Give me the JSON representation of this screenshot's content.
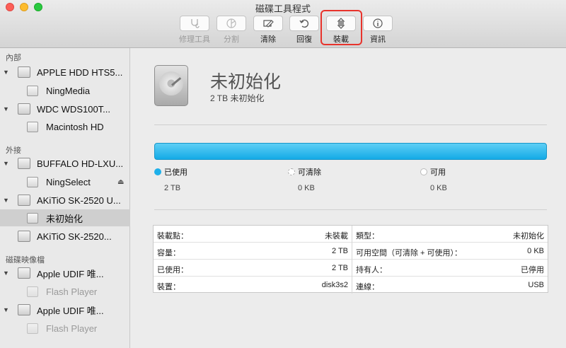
{
  "window": {
    "title": "磁碟工具程式"
  },
  "toolbar": {
    "first_aid": {
      "label": "修理工具",
      "icon": "stethoscope-icon"
    },
    "partition": {
      "label": "分割",
      "icon": "partition-icon"
    },
    "erase": {
      "label": "清除",
      "icon": "erase-icon"
    },
    "restore": {
      "label": "回復",
      "icon": "restore-icon"
    },
    "mount": {
      "label": "裝載",
      "icon": "mount-icon"
    },
    "info": {
      "label": "資訊",
      "icon": "info-icon"
    }
  },
  "sidebar": {
    "internal_header": "內部",
    "external_header": "外接",
    "images_header": "磁碟映像檔",
    "internal": [
      {
        "disk": "APPLE HDD HTS5...",
        "volume": "NingMedia"
      },
      {
        "disk": "WDC WDS100T...",
        "volume": "Macintosh HD"
      }
    ],
    "external": [
      {
        "disk": "BUFFALO HD-LXU...",
        "volume": "NingSelect"
      },
      {
        "disk": "AKiTiO SK-2520 U...",
        "volume": "未初始化"
      },
      {
        "disk": "AKiTiO SK-2520..."
      }
    ],
    "images": [
      {
        "disk": "Apple UDIF 唯...",
        "volume": "Flash Player"
      },
      {
        "disk": "Apple UDIF 唯...",
        "volume": "Flash Player"
      }
    ]
  },
  "main": {
    "disk_name": "未初始化",
    "disk_subtitle": "2 TB 未初始化",
    "usage_fraction": 1.0,
    "legend": {
      "used_label": "已使用",
      "used_value": "2 TB",
      "used_color": "#1eb0ea",
      "purgeable_label": "可清除",
      "purgeable_value": "0 KB",
      "free_label": "可用",
      "free_value": "0 KB"
    },
    "info_left": [
      {
        "key": "裝載點：",
        "value": "未裝載"
      },
      {
        "key": "容量：",
        "value": "2 TB"
      },
      {
        "key": "已使用：",
        "value": "2 TB"
      },
      {
        "key": "裝置：",
        "value": "disk3s2"
      }
    ],
    "info_right": [
      {
        "key": "類型：",
        "value": "未初始化"
      },
      {
        "key": "可用空間（可清除 + 可使用）：",
        "value": "0 KB"
      },
      {
        "key": "持有人：",
        "value": "已停用"
      },
      {
        "key": "連線：",
        "value": "USB"
      }
    ]
  },
  "colors": {
    "highlight_box": "#e8332c",
    "bar_blue": "#14aae6"
  }
}
